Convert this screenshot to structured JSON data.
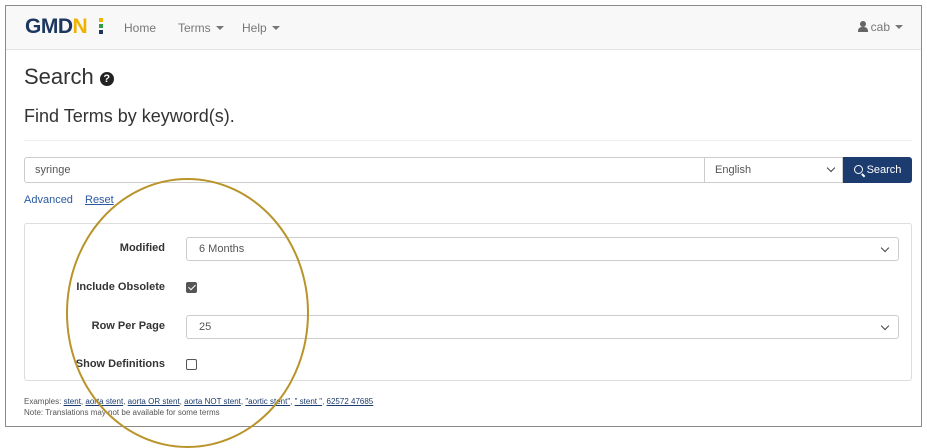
{
  "navbar": {
    "logo": "GMDN",
    "links": [
      {
        "label": "Home"
      },
      {
        "label": "Terms"
      },
      {
        "label": "Help"
      }
    ],
    "user": "cab"
  },
  "page": {
    "title": "Search",
    "subtitle": "Find Terms by keyword(s)."
  },
  "search": {
    "value": "syringe",
    "language": "English",
    "button_label": "Search",
    "advanced_link": "Advanced",
    "reset_link": "Reset"
  },
  "advanced": {
    "modified_label": "Modified",
    "modified_value": "6 Months",
    "include_obsolete_label": "Include Obsolete",
    "include_obsolete_checked": true,
    "row_per_page_label": "Row Per Page",
    "row_per_page_value": "25",
    "show_definitions_label": "Show Definitions",
    "show_definitions_checked": false
  },
  "examples": {
    "prefix": "Examples: ",
    "items": [
      "stent",
      "aorta stent",
      "aorta OR stent",
      "aorta NOT stent",
      "\"aortic stent\"",
      "\" stent \"",
      "62572 47685"
    ],
    "note": "Note: Translations may not be available for some terms"
  },
  "colors": {
    "brand_navy": "#1c3660",
    "brand_gold": "#f0b400",
    "button_bg": "#1c3b6e",
    "annotation_circle": "#b8942a"
  }
}
